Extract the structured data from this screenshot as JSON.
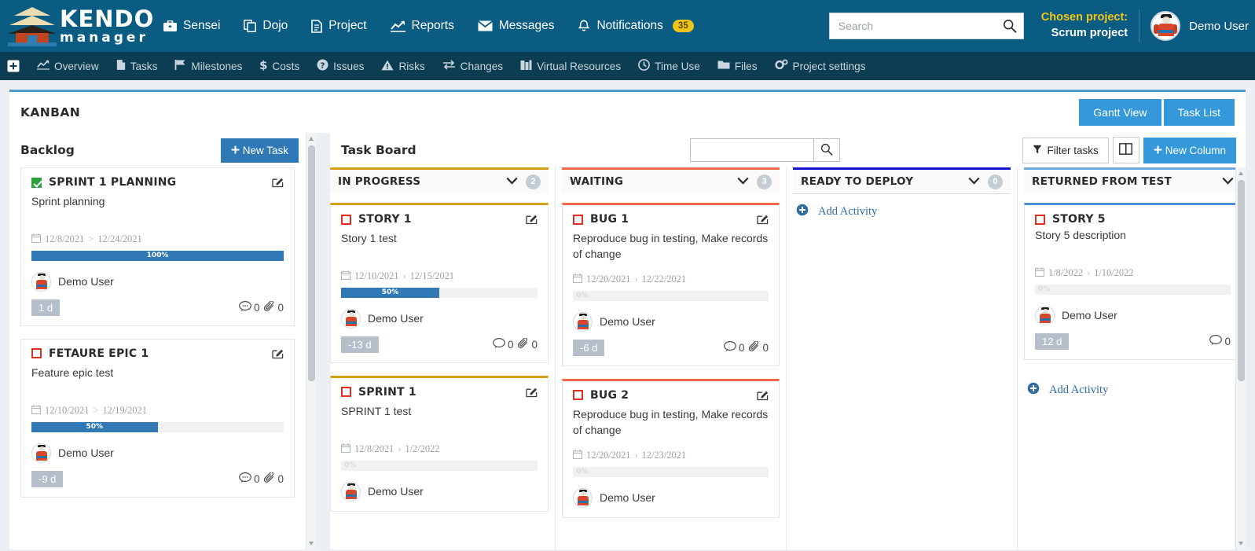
{
  "header": {
    "logo_top": "KENDO",
    "logo_bottom": "manager",
    "nav": [
      {
        "label": "Sensei",
        "icon": "briefcase-icon"
      },
      {
        "label": "Dojo",
        "icon": "copy-icon"
      },
      {
        "label": "Project",
        "icon": "file-icon"
      },
      {
        "label": "Reports",
        "icon": "chart-line-icon"
      },
      {
        "label": "Messages",
        "icon": "envelope-icon"
      },
      {
        "label": "Notifications",
        "icon": "bell-icon",
        "badge": "35"
      }
    ],
    "search": {
      "placeholder": "Search",
      "value": ""
    },
    "chosen_project_label": "Chosen project:",
    "chosen_project_value": "Scrum project",
    "user_name": "Demo User"
  },
  "subnav": [
    {
      "label": "Overview",
      "icon": "chart-line-icon"
    },
    {
      "label": "Tasks",
      "icon": "file-icon"
    },
    {
      "label": "Milestones",
      "icon": "flag-icon"
    },
    {
      "label": "Costs",
      "icon": "dollar-icon"
    },
    {
      "label": "Issues",
      "icon": "question-circle-icon"
    },
    {
      "label": "Risks",
      "icon": "warning-triangle-icon"
    },
    {
      "label": "Changes",
      "icon": "exchange-icon"
    },
    {
      "label": "Virtual Resources",
      "icon": "building-icon"
    },
    {
      "label": "Time Use",
      "icon": "clock-icon"
    },
    {
      "label": "Files",
      "icon": "folder-icon"
    },
    {
      "label": "Project settings",
      "icon": "gears-icon"
    }
  ],
  "page": {
    "title": "KANBAN",
    "gantt_view_label": "Gantt View",
    "task_list_label": "Task List"
  },
  "backlog": {
    "title": "Backlog",
    "new_task_label": "New Task",
    "cards": [
      {
        "title": "SPRINT 1 PLANNING",
        "desc": "Sprint planning",
        "checked": true,
        "date_start": "12/8/2021",
        "date_end": "12/24/2021",
        "date_sep": ">",
        "progress": 100,
        "progress_label": "100%",
        "user": "Demo User",
        "days": "1 d",
        "comments": "0",
        "attachments": "0"
      },
      {
        "title": "FETAURE EPIC 1",
        "desc": "Feature epic test",
        "checked": false,
        "date_start": "12/10/2021",
        "date_end": "12/19/2021",
        "date_sep": ">",
        "progress": 50,
        "progress_label": "50%",
        "user": "Demo User",
        "days": "-9 d",
        "comments": "0",
        "attachments": "0"
      }
    ]
  },
  "taskboard": {
    "title": "Task Board",
    "search": {
      "placeholder": "",
      "value": ""
    },
    "filter_label": "Filter tasks",
    "new_column_label": "New Column",
    "add_activity_label": "Add Activity",
    "columns": [
      {
        "name": "IN PROGRESS",
        "count": "2",
        "accent": "#d4a017",
        "cards": [
          {
            "title": "STORY 1",
            "desc": "Story 1 test",
            "checked": false,
            "date_start": "12/10/2021",
            "date_end": "12/15/2021",
            "date_sep": "›",
            "progress": 50,
            "progress_label": "50%",
            "user": "Demo User",
            "days": "-13 d",
            "comments": "0",
            "attachments": "0"
          },
          {
            "title": "SPRINT 1",
            "desc": "SPRINT 1 test",
            "checked": false,
            "date_start": "12/8/2021",
            "date_end": "1/2/2022",
            "date_sep": "›",
            "progress": 0,
            "progress_label": "0%",
            "user": "Demo User",
            "days": "",
            "comments": "",
            "attachments": ""
          }
        ]
      },
      {
        "name": "WAITING",
        "count": "3",
        "accent": "#f2694b",
        "cards": [
          {
            "title": "BUG 1",
            "desc": "Reproduce bug in testing, Make records of change",
            "checked": false,
            "date_start": "12/20/2021",
            "date_end": "12/22/2021",
            "date_sep": "›",
            "progress": 0,
            "progress_label": "0%",
            "user": "Demo User",
            "days": "-6 d",
            "comments": "0",
            "attachments": "0"
          },
          {
            "title": "BUG 2",
            "desc": "Reproduce bug in testing, Make records of change",
            "checked": false,
            "date_start": "12/20/2021",
            "date_end": "12/23/2021",
            "date_sep": "›",
            "progress": 0,
            "progress_label": "0%",
            "user": "Demo User",
            "days": "",
            "comments": "",
            "attachments": ""
          }
        ]
      },
      {
        "name": "READY TO DEPLOY",
        "count": "0",
        "accent": "#1414d2",
        "cards": []
      },
      {
        "name": "RETURNED FROM TEST",
        "count": "",
        "accent": "#6fa8dc",
        "cards": [
          {
            "title": "STORY 5",
            "desc": "Story 5 description",
            "checked": false,
            "date_start": "1/8/2022",
            "date_end": "1/10/2022",
            "date_sep": "›",
            "progress": 0,
            "progress_label": "0%",
            "user": "Demo User",
            "days": "12 d",
            "comments": "0",
            "attachments": ""
          }
        ]
      }
    ]
  }
}
